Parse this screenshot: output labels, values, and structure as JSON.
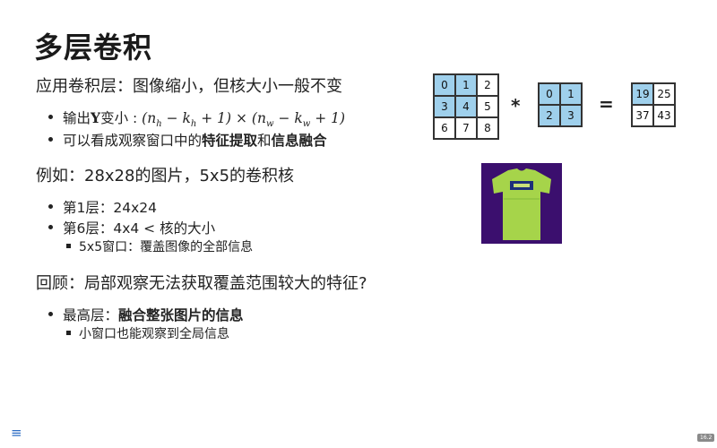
{
  "title": "多层卷积",
  "section1": {
    "heading": "应用卷积层：图像缩小，但核大小一般不变",
    "bullet1_prefix": "输出",
    "bullet1_Y": "Y",
    "bullet1_mid": "变小 : ",
    "bullet1_math": {
      "open": "(n",
      "sub_h": "h",
      "minus_k": " − k",
      "sub_kh": "h",
      "plus1": " + 1) × (n",
      "sub_w": "w",
      "minus_kw": " − k",
      "sub_kw": "w",
      "close": " + 1)"
    },
    "bullet2_pre": "可以看成观察窗口中的",
    "bullet2_bold1": "特征提取",
    "bullet2_mid": "和",
    "bullet2_bold2": "信息融合"
  },
  "section2": {
    "heading": "例如：28x28的图片，5x5的卷积核",
    "bullets": [
      "第1层：24x24",
      "第6层：4x4 < 核的大小"
    ],
    "sub_bullet": "5x5窗口：覆盖图像的全部信息"
  },
  "section3": {
    "heading": "回顾：局部观察无法获取覆盖范围较大的特征?",
    "bullet_pre": "最高层：",
    "bullet_bold": "融合整张图片的信息",
    "sub_bullet": "小窗口也能观察到全局信息"
  },
  "conv_example": {
    "input": [
      "0",
      "1",
      "2",
      "3",
      "4",
      "5",
      "6",
      "7",
      "8"
    ],
    "kernel": [
      "0",
      "1",
      "2",
      "3"
    ],
    "output": [
      "19",
      "25",
      "37",
      "43"
    ],
    "star": "*",
    "equals": "=",
    "highlight_color": "#9fd0ec"
  },
  "image_colors": {
    "background": "#3b0f6e",
    "shirt": "#a6d44a"
  },
  "footer": {
    "menu_icon": "menu-icon",
    "page_number": "16.2"
  }
}
